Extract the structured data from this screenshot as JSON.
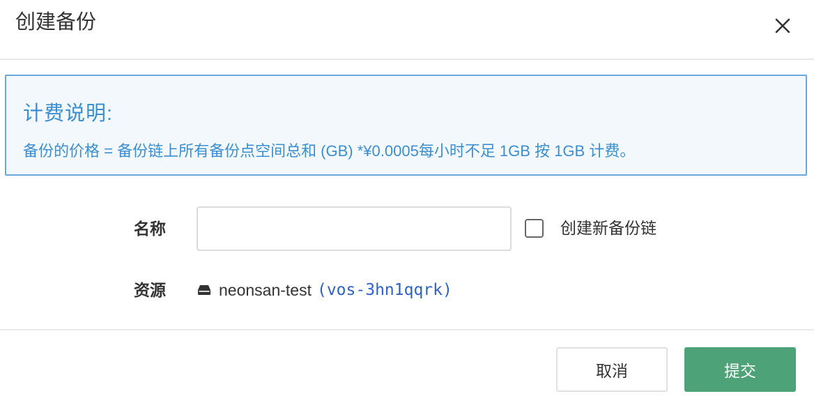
{
  "dialog": {
    "title": "创建备份"
  },
  "notice": {
    "title": "计费说明:",
    "text": "备份的价格 = 备份链上所有备份点空间总和 (GB) *¥0.0005每小时不足 1GB 按 1GB 计费。"
  },
  "form": {
    "name_label": "名称",
    "name_value": "",
    "name_placeholder": "",
    "checkbox_label": "创建新备份链",
    "checkbox_checked": false,
    "resource_label": "资源",
    "resource_name": "neonsan-test",
    "resource_id": "(vos-3hn1qqrk)"
  },
  "footer": {
    "cancel_label": "取消",
    "submit_label": "提交"
  },
  "colors": {
    "notice_text": "#3b8fd1",
    "notice_border": "#6aa7dc",
    "resource_id": "#2f62c9",
    "submit_bg": "#4ea277"
  },
  "icons": [
    "close-icon",
    "disk-icon"
  ]
}
